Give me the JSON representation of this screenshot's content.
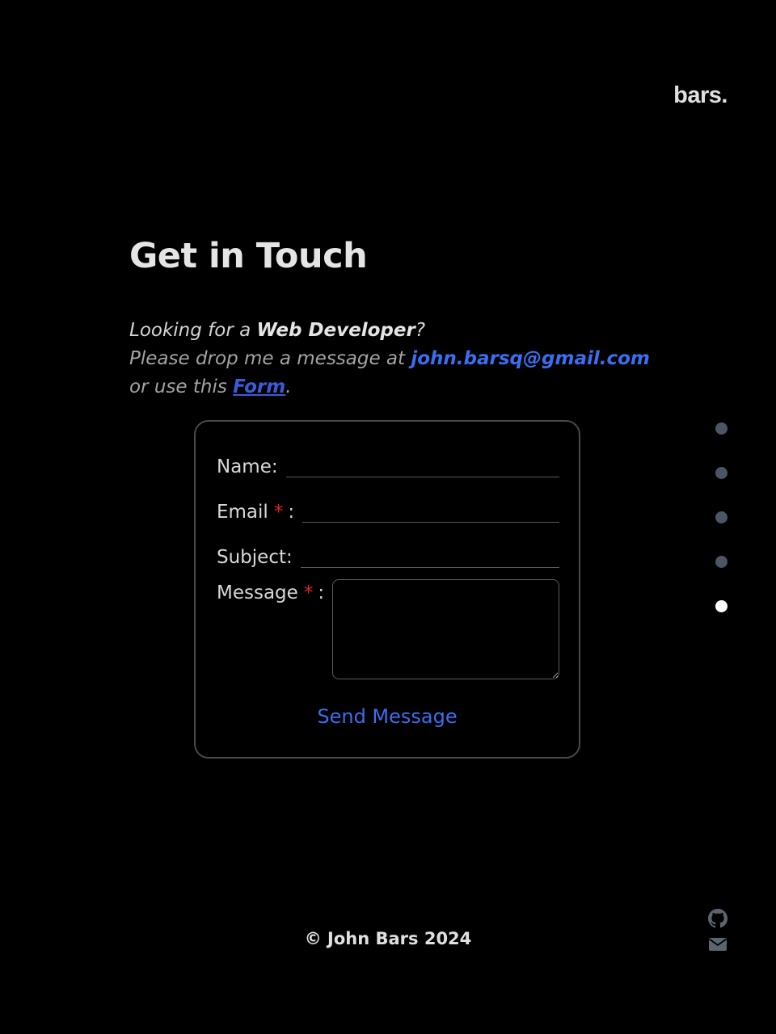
{
  "logo": "bars.",
  "heading": "Get in Touch",
  "intro": {
    "line1_prefix": "Looking for a ",
    "line1_strong": "Web Developer",
    "line1_suffix": "?",
    "line2_prefix": "Please drop me a message at ",
    "email": "john.barsq@gmail.com",
    "line3_prefix": "or use this ",
    "form_link": "Form",
    "line3_suffix": "."
  },
  "form": {
    "name_label": "Name:",
    "email_label": "Email",
    "subject_label": "Subject:",
    "message_label": "Message",
    "required_mark": "*",
    "colon": ":",
    "submit_label": "Send Message"
  },
  "section_nav": {
    "count": 5,
    "active_index": 4
  },
  "footer": "© John Bars 2024",
  "social": [
    "github-icon",
    "mail-icon"
  ]
}
